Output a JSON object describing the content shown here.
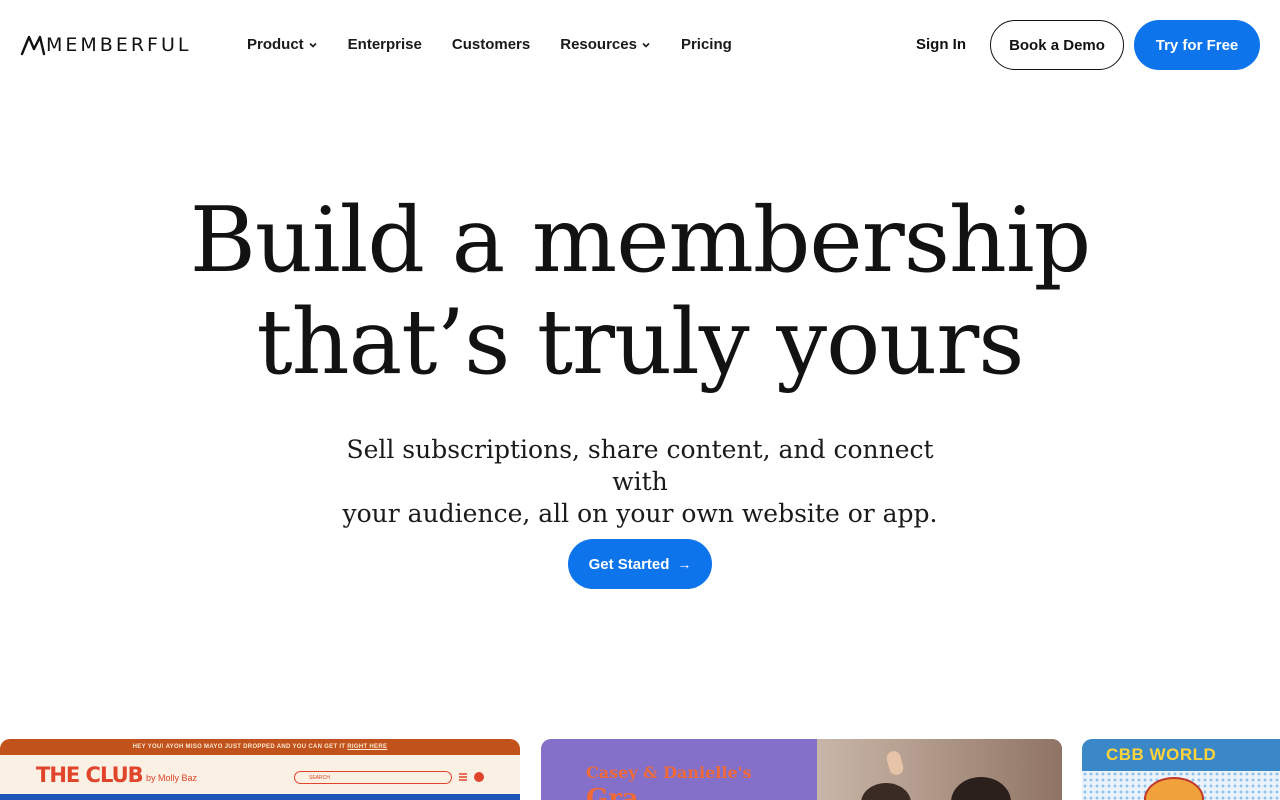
{
  "brand": {
    "name": "MEMBERFUL"
  },
  "nav": {
    "items": [
      {
        "label": "Product",
        "has_dropdown": true
      },
      {
        "label": "Enterprise",
        "has_dropdown": false
      },
      {
        "label": "Customers",
        "has_dropdown": false
      },
      {
        "label": "Resources",
        "has_dropdown": true
      },
      {
        "label": "Pricing",
        "has_dropdown": false
      }
    ],
    "sign_in": "Sign In",
    "book_demo": "Book a Demo",
    "try_free": "Try for Free"
  },
  "hero": {
    "title_line1": "Build a membership",
    "title_line2": "that’s truly yours",
    "subtitle_line1": "Sell subscriptions, share content, and connect with",
    "subtitle_line2": "your audience, all on your own website or app.",
    "cta_label": "Get Started",
    "cta_icon": "arrow-right-icon"
  },
  "showcase": {
    "card1": {
      "banner_text": "HEY YOU! AYOH MISO MAYO JUST DROPPED AND YOU CAN GET IT",
      "banner_link": "RIGHT HERE",
      "logo": "THE CLUB",
      "byline": "by Molly Baz",
      "search_placeholder": "SEARCH"
    },
    "card2": {
      "title_line1": "Casey & Danielle's",
      "title_line2": "Gra..."
    },
    "card3": {
      "title": "CBB WORLD"
    }
  },
  "colors": {
    "accent": "#0d74ec",
    "text": "#111111",
    "background": "#ffffff"
  }
}
